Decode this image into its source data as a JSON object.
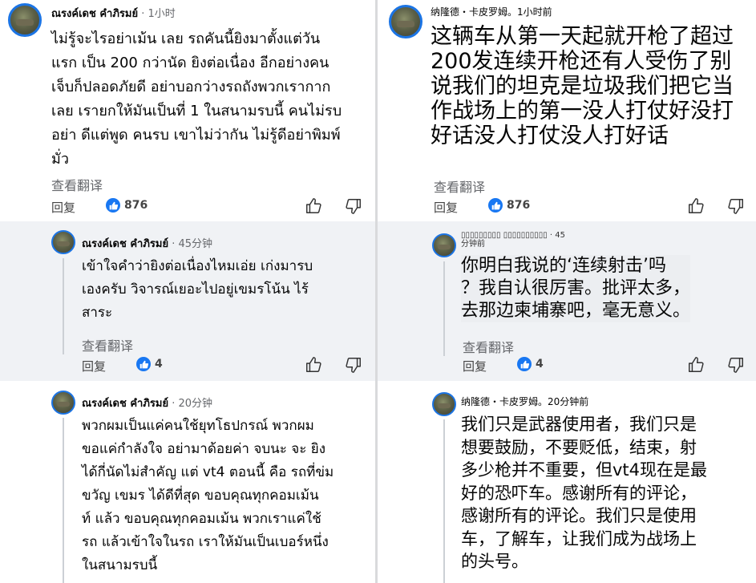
{
  "left": {
    "comments": [
      {
        "author": "ณรงค์เดช คำภิรมย์",
        "time": "· 1小时",
        "lines": [
          "ไม่รู้จะไรอย่าเม้น เลย รถคันนี้ยิงมาตั้งแต่วัน",
          "แรก เป็น 200 กว่านัด ยิงต่อเนื่อง อีกอย่างคน",
          "เจ็บก็ปลอดภัยดี อย่าบอกว่างรถถังพวกเรากาก",
          "เลย เรายกให้มันเป็นที่ 1 ในสนามรบนี้ คนไม่รบ",
          "อย่า ดีแต่พูด คนรบ เขาไม่ว่ากัน ไม่รู้ดีอย่าพิมพ์",
          "มั่ว"
        ],
        "translate": "查看翻译",
        "reply": "回复",
        "likes": "876"
      },
      {
        "author": "ณรงค์เดช คำภิรมย์",
        "time": "· 45分钟",
        "lines": [
          "เข้าใจคำว่ายิงต่อเนื่องไหมเอ่ย เก่งมารบ",
          "เองครับ วิจารณ์เยอะไปอยู่เขมรโน้น ไร้",
          "สาระ"
        ],
        "translate": "查看翻译",
        "reply": "回复",
        "likes": "4"
      },
      {
        "author": "ณรงค์เดช คำภิรมย์",
        "time": "· 20分钟",
        "lines": [
          "พวกผมเป็นแค่คนใช้ยุทโธปกรณ์  พวกผม",
          "ขอแค่กำลังใจ อย่ามาด้อยค่า จบนะ จะ ยิง",
          "ได้กี่นัดไม่สำคัญ แต่ vt4 ตอนนี้ คือ รถที่ข่ม",
          "ขวัญ เขมร ได้ดีที่สุด ขอบคุณทุกคอมเม้น",
          "ท์ แล้ว ขอบคุณทุกคอมเม้น พวกเราแค่ใช้",
          "รถ  แล้วเข้าใจในรถ เราให้มันเป็นเบอร์หนึ่ง",
          "ในสนามรบนี้"
        ]
      }
    ]
  },
  "right": {
    "comments": [
      {
        "author": "纳隆德・卡皮罗姆。1小时前",
        "lines": [
          "这辆车从第一天起就开枪了超过",
          "200发连续开枪还有人受伤了别",
          "说我们的坦克是垃圾我们把它当",
          "作战场上的第一没人打仗好没打",
          "好话没人打仗没人打好话"
        ],
        "translate": "查看翻译",
        "reply": "回复",
        "likes": "876"
      },
      {
        "author_garbled": "▯▯▯▯▯▯▯▯▯ ▯▯▯▯▯▯▯▯▯▯ · 45",
        "author_garbled_2": "分钟前",
        "lines": [
          "你明白我说的‘连续射击’吗",
          "？我自认很厉害。批评太多，",
          "去那边柬埔寨吧，毫无意义。"
        ],
        "translate": "查看翻译",
        "reply": "回复",
        "likes": "4"
      },
      {
        "author": "纳隆德・卡皮罗姆。20分钟前",
        "lines": [
          "我们只是武器使用者，我们只是",
          "想要鼓励，不要贬低，结束，射",
          "多少枪并不重要，但vt4现在是最",
          "好的恐吓车。感谢所有的评论，",
          "感谢所有的评论。我们只是使用",
          "车，了解车，让我们成为战场上",
          "的头号。"
        ]
      }
    ]
  },
  "colors": {
    "like_blue": "#1877f2",
    "avatar_ring": "#1b74e4",
    "shade": "#f0f2f5"
  }
}
